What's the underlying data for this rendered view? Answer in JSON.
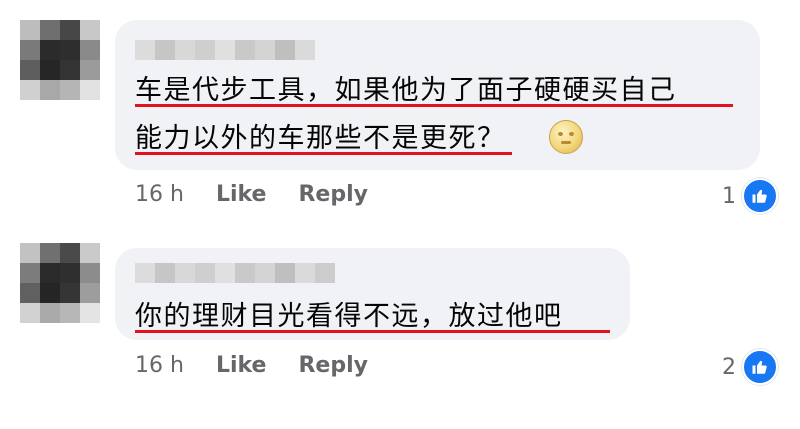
{
  "colors": {
    "bubble_bg": "#f0f2f5",
    "underline": "#e0141e",
    "meta_text": "#65676b",
    "like_blue": "#1877f2"
  },
  "comments": [
    {
      "lines": [
        "车是代步工具，如果他为了面子硬硬买自己",
        "能力以外的车那些不是更死？"
      ],
      "emoji": "full-moon-face-icon",
      "time": "16 h",
      "like_label": "Like",
      "reply_label": "Reply",
      "like_count": "1",
      "reaction_icon": "thumbs-up-icon"
    },
    {
      "lines": [
        "你的理财目光看得不远，放过他吧"
      ],
      "time": "16 h",
      "like_label": "Like",
      "reply_label": "Reply",
      "like_count": "2",
      "reaction_icon": "thumbs-up-icon"
    }
  ]
}
